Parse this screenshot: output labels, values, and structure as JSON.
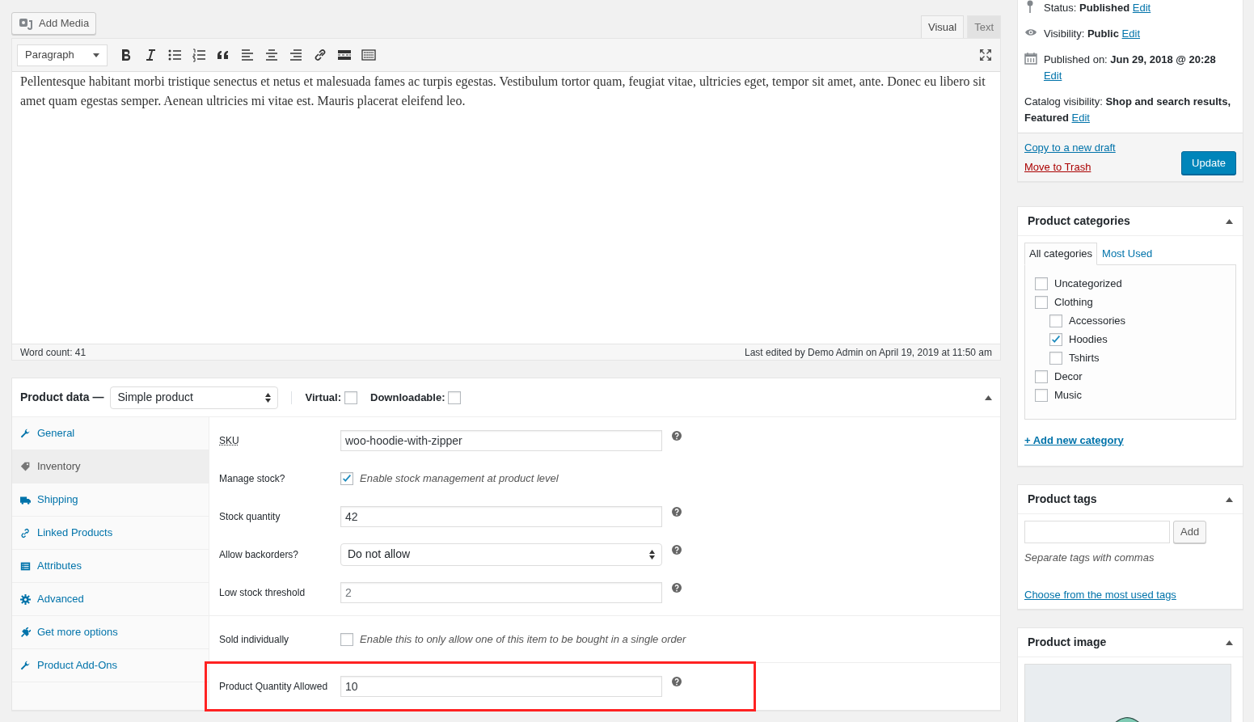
{
  "editor": {
    "add_media": "Add Media",
    "tabs": [
      {
        "label": "Visual",
        "selected": true
      },
      {
        "label": "Text",
        "selected": false
      }
    ],
    "format_select": "Paragraph",
    "content": "Pellentesque habitant morbi tristique senectus et netus et malesuada fames ac turpis egestas. Vestibulum tortor quam, feugiat vitae, ultricies eget, tempor sit amet, ante. Donec eu libero sit amet quam egestas semper. Aenean ultricies mi vitae est. Mauris placerat eleifend leo.",
    "word_count": "Word count: 41",
    "last_edited": "Last edited by Demo Admin on April 19, 2019 at 11:50 am"
  },
  "product_data": {
    "title": "Product data —",
    "type_select": "Simple product",
    "options": [
      {
        "label": "Virtual:",
        "checked": false
      },
      {
        "label": "Downloadable:",
        "checked": false
      }
    ],
    "tabs": [
      {
        "label": "General",
        "selected": false
      },
      {
        "label": "Inventory",
        "selected": true
      },
      {
        "label": "Shipping",
        "selected": false
      },
      {
        "label": "Linked Products",
        "selected": false
      },
      {
        "label": "Attributes",
        "selected": false
      },
      {
        "label": "Advanced",
        "selected": false
      },
      {
        "label": "Get more options",
        "selected": false
      },
      {
        "label": "Product Add-Ons",
        "selected": false
      }
    ],
    "groups": [
      {
        "highlighted": false,
        "fields": [
          {
            "kind": "text",
            "label": "SKU",
            "value": "woo-hoodie-with-zipper",
            "help": true
          },
          {
            "kind": "checkbox",
            "label": "Manage stock?",
            "checked": true,
            "description": "Enable stock management at product level",
            "help": false
          },
          {
            "kind": "text",
            "label": "Stock quantity",
            "value": "42",
            "help": true
          },
          {
            "kind": "select",
            "label": "Allow backorders?",
            "value": "Do not allow",
            "help": true
          },
          {
            "kind": "text",
            "label": "Low stock threshold",
            "placeholder": "2",
            "help": true
          }
        ]
      },
      {
        "highlighted": false,
        "fields": [
          {
            "kind": "checkbox",
            "label": "Sold individually",
            "checked": false,
            "description": "Enable this to only allow one of this item to be bought in a single order",
            "help": false
          }
        ]
      },
      {
        "highlighted": true,
        "fields": [
          {
            "kind": "text",
            "label": "Product Quantity Allowed",
            "value": "10",
            "help": true
          }
        ]
      }
    ]
  },
  "publish": {
    "rows": [
      {
        "label": "Status: ",
        "value": "Published",
        "link": "Edit"
      },
      {
        "label": "Visibility: ",
        "value": "Public",
        "link": "Edit"
      },
      {
        "label": "Published on: ",
        "value": "Jun 29, 2018 @ 20:28",
        "link": "Edit"
      },
      {
        "label": "Catalog visibility: ",
        "value": "Shop and search results, Featured",
        "link": "Edit"
      }
    ],
    "copy_link": "Copy to a new draft",
    "trash_link": "Move to Trash",
    "update_button": "Update"
  },
  "categories": {
    "title": "Product categories",
    "tabs": [
      {
        "label": "All categories",
        "selected": true
      },
      {
        "label": "Most Used",
        "selected": false
      }
    ],
    "items": [
      {
        "label": "Uncategorized",
        "checked": false
      },
      {
        "label": "Clothing",
        "checked": false,
        "children": [
          {
            "label": "Accessories",
            "checked": false
          },
          {
            "label": "Hoodies",
            "checked": true
          },
          {
            "label": "Tshirts",
            "checked": false
          }
        ]
      },
      {
        "label": "Decor",
        "checked": false
      },
      {
        "label": "Music",
        "checked": false
      }
    ],
    "add_link": "+ Add new category"
  },
  "tags": {
    "title": "Product tags",
    "add_button": "Add",
    "hint": "Separate tags with commas",
    "choose_link": "Choose from the most used tags"
  },
  "product_image": {
    "title": "Product image"
  }
}
